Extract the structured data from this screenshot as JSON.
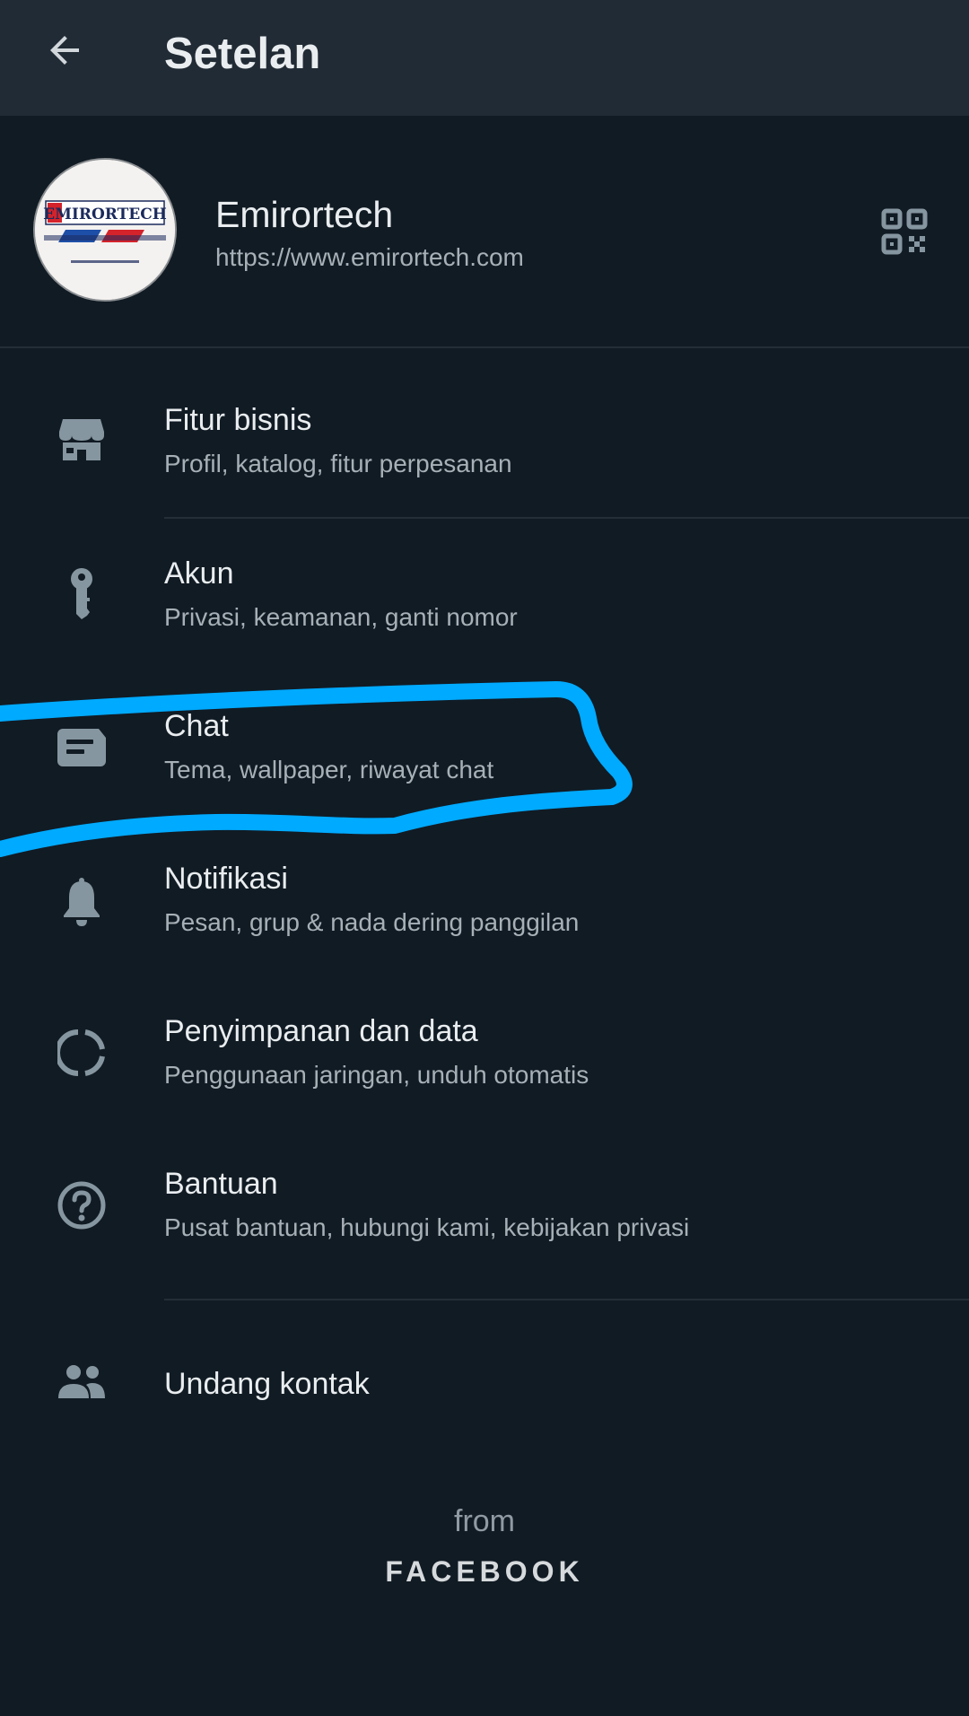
{
  "app_bar": {
    "back_icon": "arrow-left-icon",
    "title": "Setelan"
  },
  "profile": {
    "name": "Emirortech",
    "status": "https://www.emirortech.com",
    "avatar_text": "EMIRORTECH",
    "qr_icon": "qr-code-icon"
  },
  "menu": {
    "items": [
      {
        "icon": "store-icon",
        "title": "Fitur bisnis",
        "subtitle": "Profil, katalog, fitur perpesanan"
      },
      {
        "icon": "key-icon",
        "title": "Akun",
        "subtitle": "Privasi, keamanan, ganti nomor"
      },
      {
        "icon": "chat-icon",
        "title": "Chat",
        "subtitle": "Tema, wallpaper, riwayat chat"
      },
      {
        "icon": "bell-icon",
        "title": "Notifikasi",
        "subtitle": "Pesan, grup & nada dering panggilan"
      },
      {
        "icon": "storage-icon",
        "title": "Penyimpanan dan data",
        "subtitle": "Penggunaan jaringan, unduh otomatis"
      },
      {
        "icon": "help-icon",
        "title": "Bantuan",
        "subtitle": "Pusat bantuan, hubungi kami, kebijakan privasi"
      },
      {
        "icon": "people-icon",
        "title": "Undang kontak"
      }
    ]
  },
  "footer": {
    "from": "from",
    "brand": "FACEBOOK"
  },
  "colors": {
    "background": "#111b24",
    "app_bar": "#212b35",
    "icon": "#8696a0",
    "highlight_stroke": "#00aaff"
  }
}
